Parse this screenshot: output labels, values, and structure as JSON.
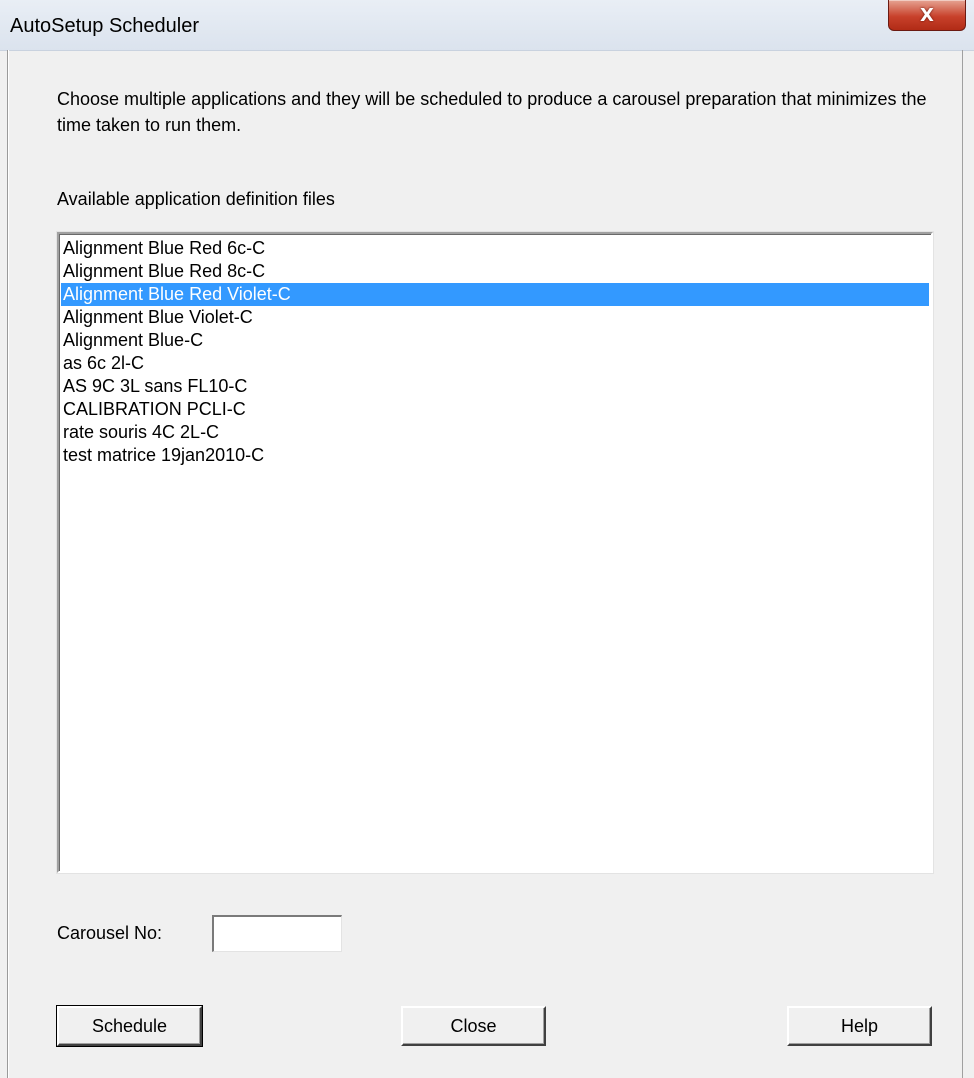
{
  "window": {
    "title": "AutoSetup Scheduler",
    "close_glyph": "X"
  },
  "description": "Choose multiple applications and they will be scheduled to produce a carousel preparation that minimizes the time taken to run them.",
  "list": {
    "label": "Available application definition files",
    "selected_index": 2,
    "items": [
      "Alignment Blue Red 6c-C",
      "Alignment Blue Red 8c-C",
      "Alignment Blue Red Violet-C",
      "Alignment Blue Violet-C",
      "Alignment Blue-C",
      "as 6c 2l-C",
      "AS 9C 3L sans FL10-C",
      "CALIBRATION PCLI-C",
      "rate souris 4C 2L-C",
      "test matrice 19jan2010-C"
    ]
  },
  "carousel": {
    "label": "Carousel No:",
    "value": ""
  },
  "buttons": {
    "schedule": "Schedule",
    "close": "Close",
    "help": "Help"
  },
  "colors": {
    "selection": "#3399ff",
    "close_button": "#c8412b"
  }
}
